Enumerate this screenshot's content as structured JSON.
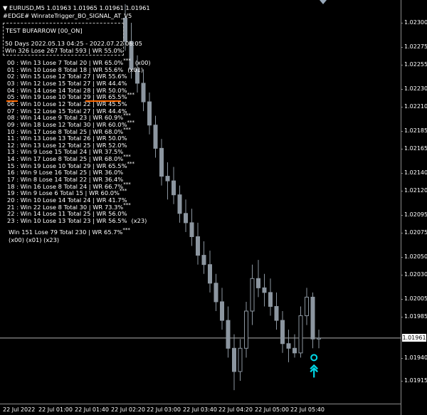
{
  "header": {
    "symbol_line": "EURUSD,M5  1.01963 1.01965 1.01961 1.01961",
    "indicator_line": "#EDGE# WinrateTrigger_BO_SIGNAL_AT_V5"
  },
  "panel": {
    "title": "TEST BUFARROW  [00_ON]",
    "range": "50 Days   2022.05.13 04:25  -  2022.07.22 06:05",
    "summary": "Win 326  Lose 267  Total 593  |  WR 55.0%"
  },
  "rows": [
    {
      "text": "00  :  Win 13  Lose 7  Total 20  |  WR 65.0%",
      "stars": "***",
      "tag": "(x00)"
    },
    {
      "text": "01  :  Win 10  Lose 8  Total 18  |  WR 55.6%",
      "stars": "",
      "tag": "(x01)"
    },
    {
      "text": "02  :  Win 15  Lose 12  Total 27  |  WR 55.6%",
      "stars": "",
      "tag": ""
    },
    {
      "text": "03  :  Win 12  Lose 15  Total 27  |  WR 44.4%",
      "stars": "",
      "tag": ""
    },
    {
      "text": "04  :  Win 14  Lose 14  Total 28  |  WR 50.0%",
      "stars": "",
      "tag": ""
    },
    {
      "text": "05  :  Win 19  Lose 10  Total 29  |  WR 65.5%",
      "stars": "***",
      "tag": ""
    },
    {
      "text": "06  :  Win 10  Lose 12  Total 22  |  WR 45.5%",
      "stars": "",
      "tag": ""
    },
    {
      "text": "07  :  Win 12  Lose 15  Total 27  |  WR 44.4%",
      "stars": "",
      "tag": ""
    },
    {
      "text": "08  :  Win 14  Lose 9  Total 23  |  WR 60.9%",
      "stars": "***",
      "tag": ""
    },
    {
      "text": "09  :  Win 18  Lose 12  Total 30  |  WR 60.0%",
      "stars": "***",
      "tag": ""
    },
    {
      "text": "10  :  Win 17  Lose 8  Total 25  |  WR 68.0%",
      "stars": "***",
      "tag": ""
    },
    {
      "text": "11  :  Win 13  Lose 13  Total 26  |  WR 50.0%",
      "stars": "",
      "tag": ""
    },
    {
      "text": "12  :  Win 13  Lose 12  Total 25  |  WR 52.0%",
      "stars": "",
      "tag": ""
    },
    {
      "text": "13  :  Win 9  Lose 15  Total 24  |  WR 37.5%",
      "stars": "",
      "tag": ""
    },
    {
      "text": "14  :  Win 17  Lose 8  Total 25  |  WR 68.0%",
      "stars": "***",
      "tag": ""
    },
    {
      "text": "15  :  Win 19  Lose 10  Total 29  |  WR 65.5%",
      "stars": "***",
      "tag": ""
    },
    {
      "text": "16  :  Win 9  Lose 16  Total 25  |  WR 36.0%",
      "stars": "",
      "tag": ""
    },
    {
      "text": "17  :  Win 8  Lose 14  Total 22  |  WR 36.4%",
      "stars": "",
      "tag": ""
    },
    {
      "text": "18  :  Win 16  Lose 8  Total 24  |  WR 66.7%",
      "stars": "***",
      "tag": ""
    },
    {
      "text": "19  :  Win 9  Lose 6  Total 15  |  WR 60.0%",
      "stars": "***",
      "tag": ""
    },
    {
      "text": "20  :  Win 10  Lose 14  Total 24  |  WR 41.7%",
      "stars": "",
      "tag": ""
    },
    {
      "text": "21  :  Win 22  Lose 8  Total 30  |  WR 73.3%",
      "stars": "***",
      "tag": ""
    },
    {
      "text": "22  :  Win 14  Lose 11  Total 25  |  WR 56.0%",
      "stars": "",
      "tag": ""
    },
    {
      "text": "23  :  Win 10  Lose 13  Total 23  |  WR 56.5%",
      "stars": "",
      "tag": "(x23)"
    }
  ],
  "totals": {
    "text": "Win 151  Lose 79  Total 230  |  WR 65.7%",
    "stars": "***",
    "tags": "(x00) (x01) (x23)"
  },
  "price_axis": {
    "labels": [
      "1.02300",
      "1.02275",
      "1.02255",
      "1.02230",
      "1.02210",
      "1.02185",
      "1.02165",
      "1.02140",
      "1.02120",
      "1.02095",
      "1.02075",
      "1.02050",
      "1.02030",
      "1.02005",
      "1.01985",
      "1.01961",
      "1.01940",
      "1.01915"
    ],
    "current_price": "1.01961"
  },
  "time_axis": {
    "labels": [
      "22 Jul 2022",
      "22 Jul 01:00",
      "22 Jul 01:40",
      "22 Jul 02:20",
      "22 Jul 03:00",
      "22 Jul 03:40",
      "22 Jul 04:20",
      "22 Jul 05:00",
      "22 Jul 05:40"
    ]
  },
  "colors": {
    "background": "#000000",
    "candle": "#8c96a0",
    "current_line": "#b0b0b0",
    "signal": "#00d8e8",
    "highlight": "#ff6a00"
  },
  "chart_data": {
    "type": "candlestick",
    "symbol": "EURUSD",
    "timeframe": "M5",
    "current_price": 1.01961,
    "candles": [
      {
        "o": 1.02305,
        "h": 1.0232,
        "l": 1.0227,
        "c": 1.0228
      },
      {
        "o": 1.0228,
        "h": 1.023,
        "l": 1.0224,
        "c": 1.0225
      },
      {
        "o": 1.0225,
        "h": 1.02265,
        "l": 1.02225,
        "c": 1.02235
      },
      {
        "o": 1.02235,
        "h": 1.0225,
        "l": 1.02205,
        "c": 1.02215
      },
      {
        "o": 1.02215,
        "h": 1.02225,
        "l": 1.0218,
        "c": 1.0219
      },
      {
        "o": 1.0219,
        "h": 1.022,
        "l": 1.02155,
        "c": 1.02165
      },
      {
        "o": 1.02165,
        "h": 1.02175,
        "l": 1.02125,
        "c": 1.02135
      },
      {
        "o": 1.02135,
        "h": 1.0215,
        "l": 1.0211,
        "c": 1.0213
      },
      {
        "o": 1.0213,
        "h": 1.02145,
        "l": 1.02105,
        "c": 1.02115
      },
      {
        "o": 1.02115,
        "h": 1.02125,
        "l": 1.02085,
        "c": 1.02095
      },
      {
        "o": 1.02095,
        "h": 1.0211,
        "l": 1.02075,
        "c": 1.02085
      },
      {
        "o": 1.02085,
        "h": 1.021,
        "l": 1.0206,
        "c": 1.0207
      },
      {
        "o": 1.0207,
        "h": 1.02085,
        "l": 1.0204,
        "c": 1.0205
      },
      {
        "o": 1.0205,
        "h": 1.02065,
        "l": 1.0203,
        "c": 1.0204
      },
      {
        "o": 1.0204,
        "h": 1.02055,
        "l": 1.0201,
        "c": 1.0202
      },
      {
        "o": 1.0202,
        "h": 1.0203,
        "l": 1.0199,
        "c": 1.02
      },
      {
        "o": 1.02,
        "h": 1.02015,
        "l": 1.0197,
        "c": 1.0198
      },
      {
        "o": 1.0198,
        "h": 1.01995,
        "l": 1.0194,
        "c": 1.0195
      },
      {
        "o": 1.0195,
        "h": 1.01965,
        "l": 1.01905,
        "c": 1.01925
      },
      {
        "o": 1.01925,
        "h": 1.0196,
        "l": 1.01915,
        "c": 1.0195
      },
      {
        "o": 1.0195,
        "h": 1.02,
        "l": 1.0194,
        "c": 1.0199
      },
      {
        "o": 1.0199,
        "h": 1.0204,
        "l": 1.01975,
        "c": 1.02025
      },
      {
        "o": 1.02025,
        "h": 1.02045,
        "l": 1.02005,
        "c": 1.02015
      },
      {
        "o": 1.02015,
        "h": 1.0203,
        "l": 1.01995,
        "c": 1.0201
      },
      {
        "o": 1.0201,
        "h": 1.02025,
        "l": 1.01985,
        "c": 1.01995
      },
      {
        "o": 1.01995,
        "h": 1.0201,
        "l": 1.0197,
        "c": 1.0198
      },
      {
        "o": 1.0198,
        "h": 1.0199,
        "l": 1.01945,
        "c": 1.01955
      },
      {
        "o": 1.01955,
        "h": 1.0197,
        "l": 1.01935,
        "c": 1.0195
      },
      {
        "o": 1.0195,
        "h": 1.01965,
        "l": 1.0194,
        "c": 1.01945
      },
      {
        "o": 1.01945,
        "h": 1.01995,
        "l": 1.0194,
        "c": 1.01985
      },
      {
        "o": 1.01985,
        "h": 1.02015,
        "l": 1.01975,
        "c": 1.02005
      },
      {
        "o": 1.02005,
        "h": 1.0201,
        "l": 1.0195,
        "c": 1.0196
      },
      {
        "o": 1.0196,
        "h": 1.0197,
        "l": 1.0195,
        "c": 1.01961
      }
    ],
    "signal": {
      "type": "up-arrow",
      "price": 1.0194
    }
  }
}
